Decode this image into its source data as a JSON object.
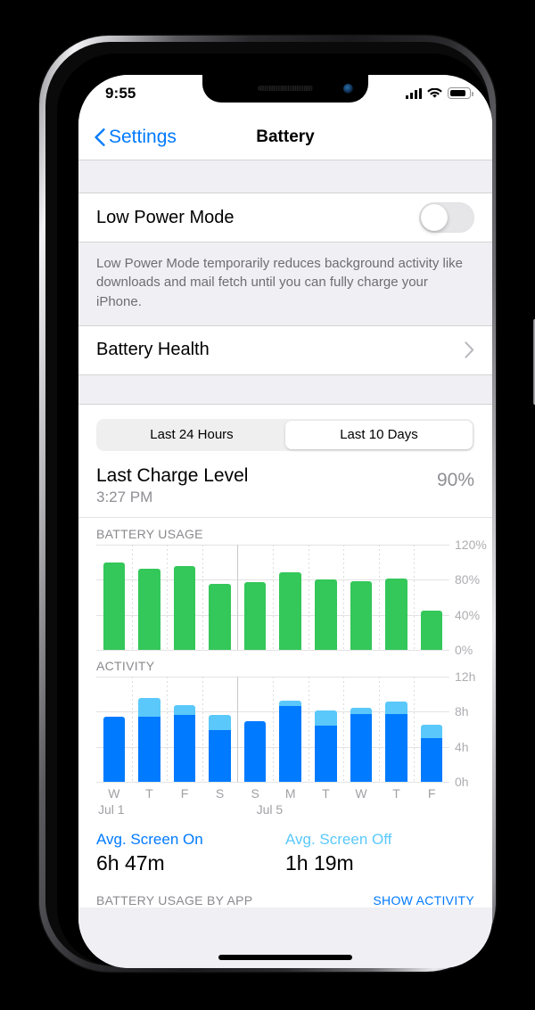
{
  "status_bar": {
    "time": "9:55",
    "signal_bars": 4,
    "wifi": "wifi-icon",
    "battery_fill_pct": 75
  },
  "nav": {
    "back_label": "Settings",
    "title": "Battery"
  },
  "low_power": {
    "label": "Low Power Mode",
    "toggle_state": "off",
    "footnote": "Low Power Mode temporarily reduces background activity like downloads and mail fetch until you can fully charge your iPhone."
  },
  "battery_health": {
    "label": "Battery Health"
  },
  "segmented": {
    "options": [
      "Last 24 Hours",
      "Last 10 Days"
    ],
    "selected": "Last 10 Days"
  },
  "last_charge": {
    "title": "Last Charge Level",
    "time": "3:27 PM",
    "value": "90%"
  },
  "averages": {
    "screen_on_label": "Avg. Screen On",
    "screen_on_value": "6h 47m",
    "screen_off_label": "Avg. Screen Off",
    "screen_off_value": "1h 19m"
  },
  "bottom": {
    "usage_by_app": "BATTERY USAGE BY APP",
    "show_activity": "SHOW ACTIVITY"
  },
  "colors": {
    "green": "#34C759",
    "blue": "#007AFF",
    "light_blue": "#5AC8FA",
    "gray_text": "#8E8E93",
    "group_bg": "#EFEFF4"
  },
  "chart_data": [
    {
      "type": "bar",
      "title": "BATTERY USAGE",
      "categories": [
        "W",
        "T",
        "F",
        "S",
        "S",
        "M",
        "T",
        "W",
        "T",
        "F"
      ],
      "values": [
        100,
        92,
        96,
        75,
        77,
        88,
        80,
        78,
        81,
        45
      ],
      "ylabel": "",
      "xlabel": "",
      "ylim": [
        0,
        120
      ],
      "yticks": [
        0,
        40,
        80,
        120
      ],
      "ytick_labels": [
        "0%",
        "40%",
        "80%",
        "120%"
      ],
      "grid": true,
      "legend": "none",
      "series_color": "#34C759"
    },
    {
      "type": "bar",
      "title": "ACTIVITY",
      "stacked": true,
      "categories": [
        "W",
        "T",
        "F",
        "S",
        "S",
        "M",
        "T",
        "W",
        "T",
        "F"
      ],
      "date_markers": [
        {
          "label": "Jul 1",
          "index": 0
        },
        {
          "label": "Jul 5",
          "index": 4
        }
      ],
      "series": [
        {
          "name": "Screen On",
          "color": "#007AFF",
          "values": [
            7.4,
            7.4,
            7.6,
            5.9,
            6.9,
            8.6,
            6.4,
            7.7,
            7.7,
            5.0
          ]
        },
        {
          "name": "Screen Off",
          "color": "#5AC8FA",
          "values": [
            0.0,
            2.2,
            1.1,
            1.7,
            0.0,
            0.6,
            1.7,
            0.7,
            1.4,
            1.5
          ]
        }
      ],
      "ylabel": "",
      "xlabel": "",
      "ylim": [
        0,
        12
      ],
      "yticks": [
        0,
        4,
        8,
        12
      ],
      "ytick_labels": [
        "0h",
        "4h",
        "8h",
        "12h"
      ],
      "grid": true,
      "legend": "none"
    }
  ]
}
